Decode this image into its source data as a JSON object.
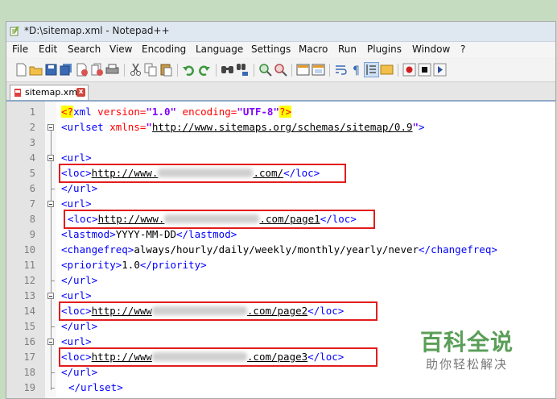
{
  "window": {
    "title": "*D:\\sitemap.xml - Notepad++"
  },
  "menu": [
    "File",
    "Edit",
    "Search",
    "View",
    "Encoding",
    "Language",
    "Settings",
    "Macro",
    "Run",
    "Plugins",
    "Window",
    "?"
  ],
  "toolbar_icons": [
    "new-file-icon",
    "open-file-icon",
    "save-icon",
    "save-all-icon",
    "close-icon",
    "close-all-icon",
    "print-icon",
    "cut-icon",
    "copy-icon",
    "paste-icon",
    "undo-icon",
    "redo-icon",
    "find-icon",
    "replace-icon",
    "zoom-in-icon",
    "zoom-out-icon",
    "sync-vertical-icon",
    "sync-horizontal-icon",
    "word-wrap-icon",
    "show-all-chars-icon",
    "indent-guide-icon",
    "user-lang-icon",
    "record-macro-icon",
    "stop-macro-icon",
    "play-macro-icon"
  ],
  "tab": {
    "label": "sitemap.xml",
    "close": "x"
  },
  "editor": {
    "line_numbers": [
      "1",
      "2",
      "3",
      "4",
      "5",
      "6",
      "7",
      "8",
      "9",
      "10",
      "11",
      "12",
      "13",
      "14",
      "15",
      "16",
      "17",
      "18",
      "19"
    ],
    "lines": {
      "l1": {
        "open": "<?",
        "xml": "xml ",
        "attr1": "version=",
        "val1": "\"1.0\"",
        "attr2": " encoding=",
        "val2": "\"UTF-8\"",
        "close": "?>"
      },
      "l2": {
        "tag": "<urlset ",
        "attr": "xmlns=",
        "q1": "\"",
        "url": "http://www.sitemaps.org/schemas/sitemap/0.9",
        "q2": "\"",
        "end": ">"
      },
      "l4": "<url>",
      "l5": {
        "open": "<loc>",
        "url_a": "http://www.",
        "url_b": ".com/",
        "close": "</loc>"
      },
      "l6": "</url>",
      "l7": "<url>",
      "l8": {
        "open": "<loc>",
        "url_a": "http://www.",
        "url_b": ".com/page1",
        "close": "</loc>"
      },
      "l9": {
        "open": "<lastmod>",
        "text": "YYYY-MM-DD",
        "close": "</lastmod>"
      },
      "l10": {
        "open": "<changefreq>",
        "text": "always/hourly/daily/weekly/monthly/yearly/never",
        "close": "</changefreq>"
      },
      "l11": {
        "open": "<priority>",
        "text": "1.0",
        "close": "</priority>"
      },
      "l12": "</url>",
      "l13": "<url>",
      "l14": {
        "open": "<loc>",
        "url_a": "http://www",
        "url_b": ".com/page2",
        "close": "</loc>"
      },
      "l15": "</url>",
      "l16": "<url>",
      "l17": {
        "open": "<loc>",
        "url_a": "http://www",
        "url_b": ".com/page3",
        "close": "</loc>"
      },
      "l18": "</url>",
      "l19": "</urlset>"
    }
  },
  "watermark": {
    "title": "百科全说",
    "subtitle": "助你轻松解决"
  },
  "colors": {
    "background": "#c5dcc0",
    "highlight_box": "#e31c1c",
    "tag": "#0000ff",
    "attribute": "#ff0000",
    "value": "#8000ff"
  }
}
